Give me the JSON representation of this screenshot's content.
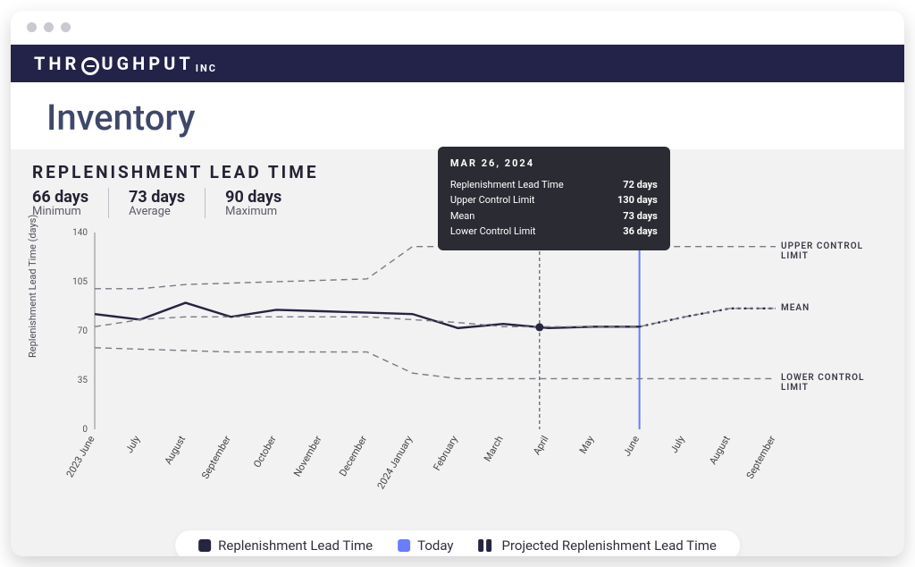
{
  "brand": {
    "pre": "THR",
    "post": "UGHPUT",
    "suffix": "INC"
  },
  "page_title": "Inventory",
  "section_title": "REPLENISHMENT LEAD TIME",
  "stats": [
    {
      "value": "66 days",
      "label": "Minimum"
    },
    {
      "value": "73 days",
      "label": "Average"
    },
    {
      "value": "90 days",
      "label": "Maximum"
    }
  ],
  "y_axis_title": "Replenishment Lead Time (days)",
  "series_labels": {
    "upper": "UPPER CONTROL LIMIT",
    "mean": "MEAN",
    "lower": "LOWER CONTROL LIMIT"
  },
  "tooltip": {
    "date": "MAR 26, 2024",
    "rows": [
      {
        "label": "Replenishment Lead Time",
        "value": "72 days"
      },
      {
        "label": "Upper Control Limit",
        "value": "130 days"
      },
      {
        "label": "Mean",
        "value": "73 days"
      },
      {
        "label": "Lower Control Limit",
        "value": "36 days"
      }
    ]
  },
  "legend": {
    "solid": "Replenishment Lead Time",
    "today": "Today",
    "proj": "Projected Replenishment Lead Time"
  },
  "chart_data": {
    "type": "line",
    "xlabel": "",
    "ylabel": "Replenishment Lead Time (days)",
    "ylim": [
      0,
      140
    ],
    "y_ticks": [
      0,
      35,
      70,
      105,
      140
    ],
    "categories": [
      "2023 June",
      "July",
      "August",
      "September",
      "October",
      "November",
      "December",
      "2024 January",
      "February",
      "March",
      "April",
      "May",
      "June",
      "July",
      "August",
      "September"
    ],
    "observed_end_index": 12,
    "today_index": 12,
    "hover_index": 9.8,
    "series": [
      {
        "name": "Replenishment Lead Time",
        "style": "solid",
        "values": [
          82,
          78,
          90,
          80,
          85,
          84,
          83,
          82,
          72,
          75,
          72,
          73,
          73,
          null,
          null,
          null
        ]
      },
      {
        "name": "Projected Replenishment Lead Time",
        "style": "dotted",
        "values": [
          null,
          null,
          null,
          null,
          null,
          null,
          null,
          null,
          null,
          null,
          null,
          null,
          73,
          80,
          86,
          86
        ]
      },
      {
        "name": "Upper Control Limit",
        "style": "dashed",
        "values": [
          100,
          100,
          103,
          104,
          105,
          106,
          107,
          130,
          130,
          130,
          130,
          130,
          130,
          130,
          130,
          130
        ]
      },
      {
        "name": "Mean",
        "style": "dashed",
        "values": [
          73,
          78,
          80,
          80,
          80,
          80,
          80,
          78,
          76,
          73,
          73,
          73,
          73,
          80,
          86,
          86
        ]
      },
      {
        "name": "Lower Control Limit",
        "style": "dashed",
        "values": [
          58,
          57,
          56,
          55,
          55,
          55,
          55,
          40,
          36,
          36,
          36,
          36,
          36,
          36,
          36,
          36
        ]
      }
    ]
  }
}
